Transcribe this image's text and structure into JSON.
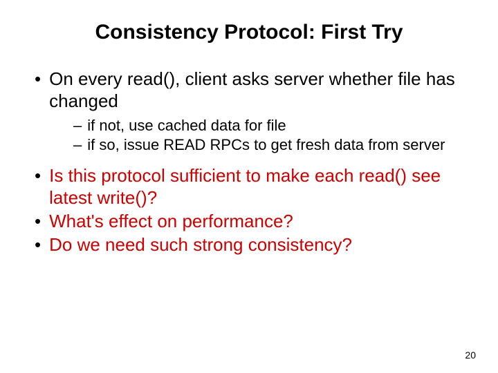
{
  "title": "Consistency Protocol: First Try",
  "bullets": [
    {
      "text": "On every read(), client asks server whether file has changed",
      "red": false,
      "sub": [
        "if not, use cached data for file",
        "if so, issue READ RPCs to get fresh data from server"
      ]
    },
    {
      "text": "Is this protocol sufficient to make each read() see latest write()?",
      "red": true,
      "sub": []
    },
    {
      "text": "What's effect on performance?",
      "red": true,
      "sub": []
    },
    {
      "text": "Do we need such strong consistency?",
      "red": true,
      "sub": []
    }
  ],
  "pageNumber": "20"
}
